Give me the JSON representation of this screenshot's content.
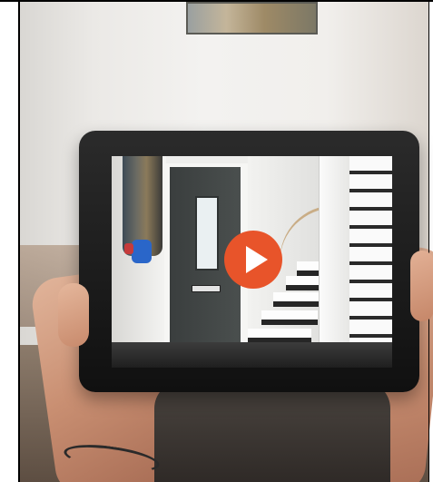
{
  "scene": {
    "description_tag": "tablet-video-preview",
    "accent_color": "#e8542a"
  },
  "video_player": {
    "play_icon": "play-icon",
    "play_button_color": "#e8542a"
  }
}
